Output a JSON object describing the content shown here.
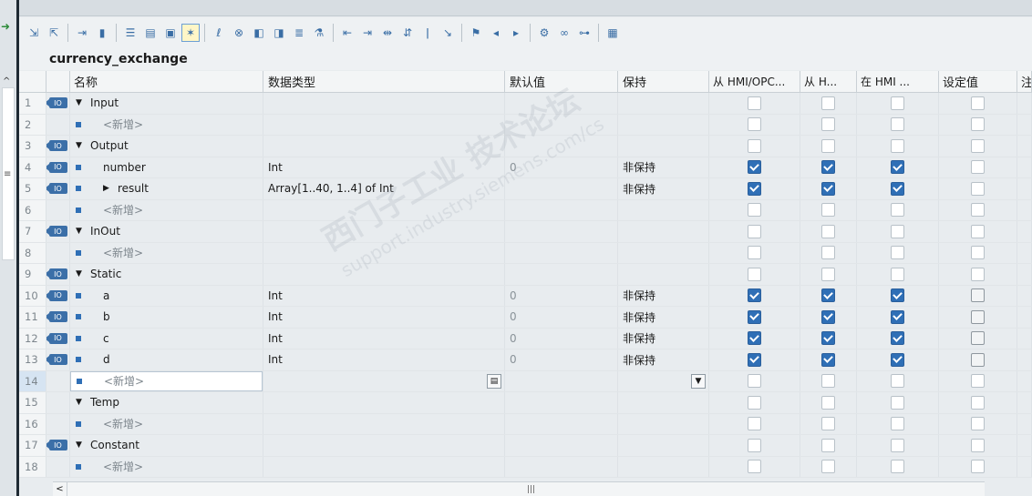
{
  "block": {
    "title": "currency_exchange"
  },
  "columns": {
    "name": "名称",
    "type": "数据类型",
    "default": "默认值",
    "retain": "保持",
    "hmi_opc": "从 HMI/OPC...",
    "hmi_h": "从 H...",
    "in_hmi": "在 HMI ...",
    "setpoint": "设定值",
    "comment": "注"
  },
  "rows": [
    {
      "n": "1",
      "kind": "section",
      "name": "Input",
      "type": "",
      "def": "",
      "retain": "",
      "chk": [
        false,
        false,
        false,
        false
      ],
      "icon": true,
      "caret": "down"
    },
    {
      "n": "2",
      "kind": "new",
      "name": "<新增>",
      "type": "",
      "def": "",
      "retain": "",
      "chk": [
        false,
        false,
        false,
        false
      ],
      "icon": false
    },
    {
      "n": "3",
      "kind": "section",
      "name": "Output",
      "type": "",
      "def": "",
      "retain": "",
      "chk": [
        false,
        false,
        false,
        false
      ],
      "icon": true,
      "caret": "down"
    },
    {
      "n": "4",
      "kind": "var",
      "name": "number",
      "type": "Int",
      "def": "0",
      "retain": "非保持",
      "chk": [
        true,
        true,
        true,
        false
      ],
      "icon": true
    },
    {
      "n": "5",
      "kind": "var",
      "name": "result",
      "type": "Array[1..40, 1..4] of Int",
      "def": "",
      "retain": "非保持",
      "chk": [
        true,
        true,
        true,
        false
      ],
      "icon": true,
      "caret": "right"
    },
    {
      "n": "6",
      "kind": "new",
      "name": "<新增>",
      "type": "",
      "def": "",
      "retain": "",
      "chk": [
        false,
        false,
        false,
        false
      ],
      "icon": false
    },
    {
      "n": "7",
      "kind": "section",
      "name": "InOut",
      "type": "",
      "def": "",
      "retain": "",
      "chk": [
        false,
        false,
        false,
        false
      ],
      "icon": true,
      "caret": "down"
    },
    {
      "n": "8",
      "kind": "new",
      "name": "<新增>",
      "type": "",
      "def": "",
      "retain": "",
      "chk": [
        false,
        false,
        false,
        false
      ],
      "icon": false
    },
    {
      "n": "9",
      "kind": "section",
      "name": "Static",
      "type": "",
      "def": "",
      "retain": "",
      "chk": [
        false,
        false,
        false,
        false
      ],
      "icon": true,
      "caret": "down"
    },
    {
      "n": "10",
      "kind": "var",
      "name": "a",
      "type": "Int",
      "def": "0",
      "retain": "非保持",
      "chk": [
        true,
        true,
        true,
        "grey"
      ],
      "icon": true
    },
    {
      "n": "11",
      "kind": "var",
      "name": "b",
      "type": "Int",
      "def": "0",
      "retain": "非保持",
      "chk": [
        true,
        true,
        true,
        "grey"
      ],
      "icon": true
    },
    {
      "n": "12",
      "kind": "var",
      "name": "c",
      "type": "Int",
      "def": "0",
      "retain": "非保持",
      "chk": [
        true,
        true,
        true,
        "grey"
      ],
      "icon": true
    },
    {
      "n": "13",
      "kind": "var",
      "name": "d",
      "type": "Int",
      "def": "0",
      "retain": "非保持",
      "chk": [
        true,
        true,
        true,
        "grey"
      ],
      "icon": true
    },
    {
      "n": "14",
      "kind": "new-edit",
      "name": "<新增>",
      "type": "",
      "def": "",
      "retain": "",
      "chk": [
        false,
        false,
        false,
        false
      ],
      "icon": false
    },
    {
      "n": "15",
      "kind": "section",
      "name": "Temp",
      "type": "",
      "def": "",
      "retain": "",
      "chk": [
        false,
        false,
        false,
        false
      ],
      "icon": false,
      "caret": "down"
    },
    {
      "n": "16",
      "kind": "new",
      "name": "<新增>",
      "type": "",
      "def": "",
      "retain": "",
      "chk": [
        false,
        false,
        false,
        false
      ],
      "icon": false
    },
    {
      "n": "17",
      "kind": "section",
      "name": "Constant",
      "type": "",
      "def": "",
      "retain": "",
      "chk": [
        false,
        false,
        false,
        false
      ],
      "icon": true,
      "caret": "down"
    },
    {
      "n": "18",
      "kind": "new",
      "name": "<新增>",
      "type": "",
      "def": "",
      "retain": "",
      "chk": [
        false,
        false,
        false,
        false
      ],
      "icon": false
    }
  ],
  "watermark": {
    "line1": "西门子工业 技术论坛",
    "line2": "support.industry.siemens.com/cs"
  },
  "icons": {
    "var_icon": "IO",
    "caret_down": "▼",
    "caret_right": "▶",
    "scroll_left": "<",
    "scroll_grip": "|||",
    "collapse": "^",
    "grip": "≡"
  }
}
